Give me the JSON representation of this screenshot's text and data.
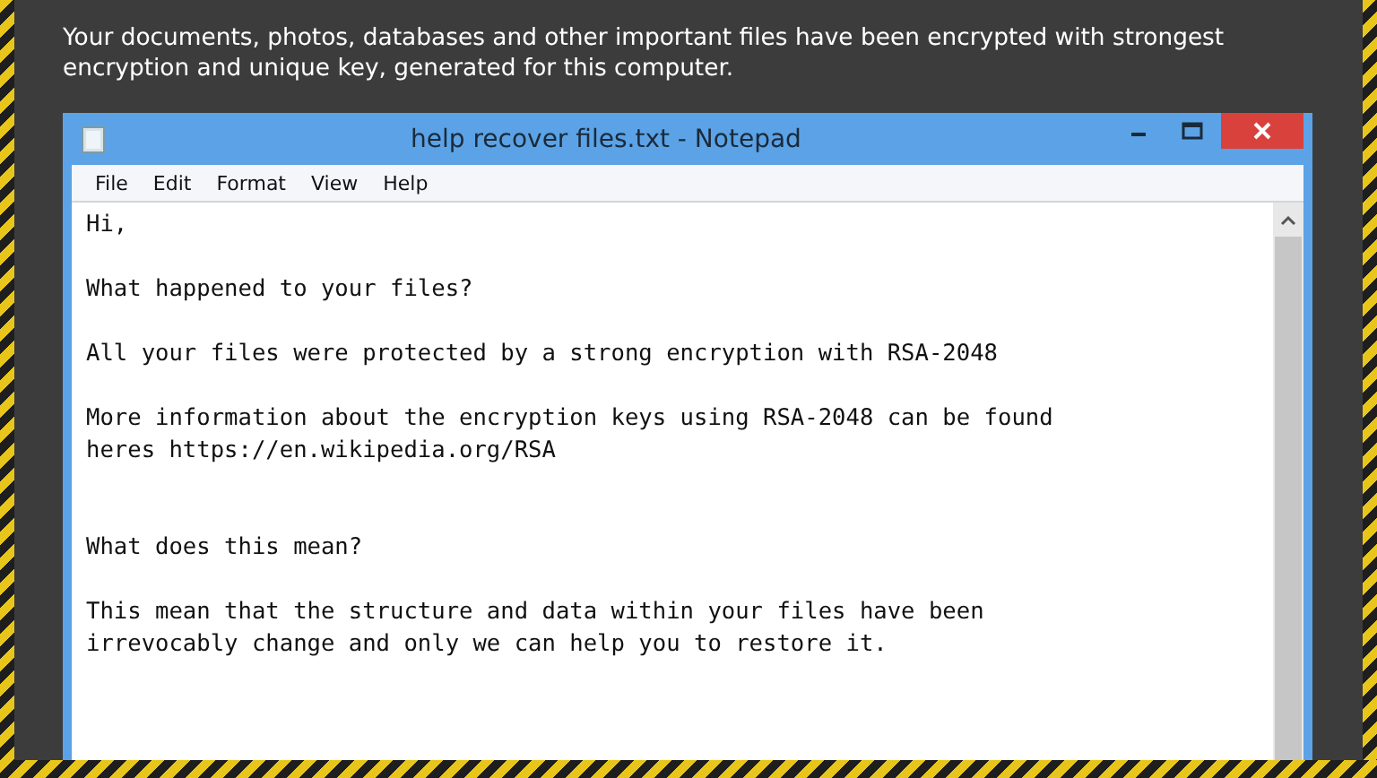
{
  "heading": "Your documents, photos, databases and other important files have been encrypted with strongest encryption and unique key, generated for this computer.",
  "window": {
    "title": "help recover files.txt - Notepad"
  },
  "menu": [
    "File",
    "Edit",
    "Format",
    "View",
    "Help"
  ],
  "document": "Hi,\n\nWhat happened to your files?\n\nAll your files were protected by a strong encryption with RSA-2048\n\nMore information about the encryption keys using RSA-2048 can be found\nheres https://en.wikipedia.org/RSA\n\n\nWhat does this mean?\n\nThis mean that the structure and data within your files have been\nirrevocably change and only we can help you to restore it."
}
